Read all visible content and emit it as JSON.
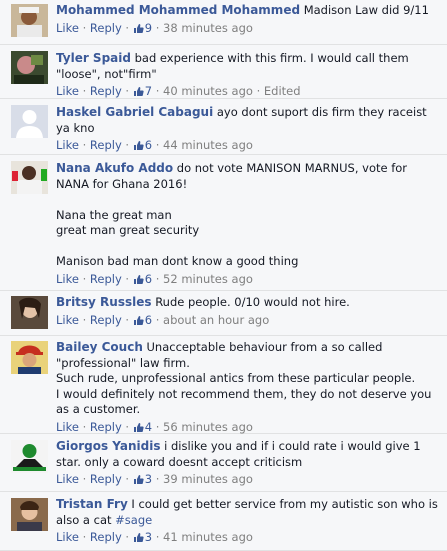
{
  "actions": {
    "like": "Like",
    "reply": "Reply",
    "dot": "·"
  },
  "comments": [
    {
      "author": "Mohammed Mohammed Mohammed",
      "text": "Madison Law did 9/11",
      "likes": "9",
      "time": "38 minutes ago",
      "edited": ""
    },
    {
      "author": "Tyler Spaid",
      "text": "bad experience with this firm. I would call them \"loose\", not\"firm\"",
      "likes": "7",
      "time": "40 minutes ago",
      "edited": "Edited"
    },
    {
      "author": "Haskel Gabriel Cabagui",
      "text": "ayo dont suport dis firm they raceist ya kno",
      "likes": "6",
      "time": "44 minutes ago",
      "edited": ""
    },
    {
      "author": "Nana Akufo Addo",
      "text": "do not vote MANISON MARNUS, vote for NANA for Ghana 2016!\n\nNana the great man\ngreat man great security\n\nManison bad man dont know a good thing",
      "likes": "6",
      "time": "52 minutes ago",
      "edited": ""
    },
    {
      "author": "Britsy Russles",
      "text": "Rude people. 0/10 would not hire.",
      "likes": "6",
      "time": "about an hour ago",
      "edited": ""
    },
    {
      "author": "Bailey Couch",
      "text": "Unacceptable behaviour from a so called \"professional\" law firm.\nSuch rude, unprofessional antics from these particular people.\nI would definitely not recommend them, they do not deserve you as a customer.",
      "likes": "4",
      "time": "56 minutes ago",
      "edited": ""
    },
    {
      "author": "Giorgos Yanidis",
      "text": "i dislike you and if i could rate i would give 1 star. only a coward doesnt accept criticism",
      "likes": "3",
      "time": "39 minutes ago",
      "edited": ""
    },
    {
      "author": "Tristan Fry",
      "text": "I could get better service from my autistic son who is also a cat",
      "hashtag": "#sage",
      "likes": "3",
      "time": "41 minutes ago",
      "edited": ""
    }
  ]
}
